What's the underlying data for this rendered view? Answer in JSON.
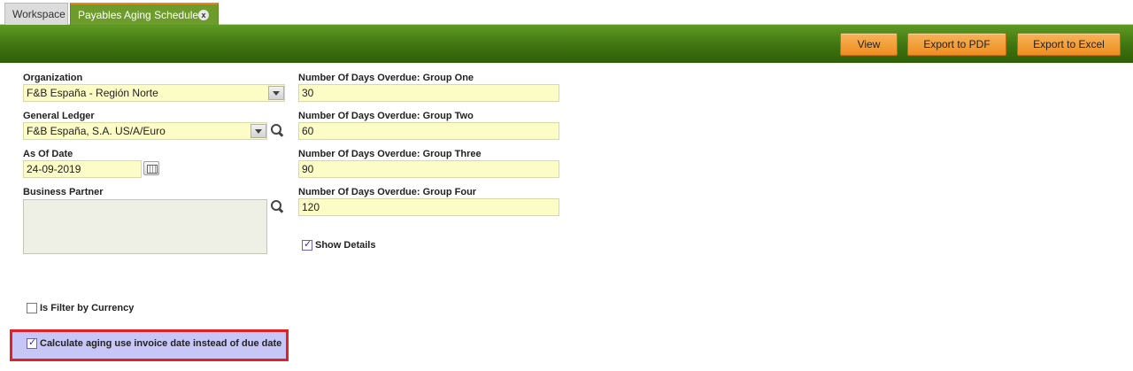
{
  "tabs": {
    "workspace": "Workspace",
    "active": "Payables Aging Schedule",
    "close_glyph": "x"
  },
  "toolbar": {
    "view": "View",
    "export_pdf": "Export to PDF",
    "export_excel": "Export to Excel"
  },
  "form": {
    "organization": {
      "label": "Organization",
      "value": "F&B España - Región Norte"
    },
    "general_ledger": {
      "label": "General Ledger",
      "value": "F&B España, S.A. US/A/Euro"
    },
    "as_of_date": {
      "label": "As Of Date",
      "value": "24-09-2019"
    },
    "business_partner": {
      "label": "Business Partner",
      "value": ""
    },
    "group_one": {
      "label": "Number Of Days Overdue: Group One",
      "value": "30"
    },
    "group_two": {
      "label": "Number Of Days Overdue: Group Two",
      "value": "60"
    },
    "group_three": {
      "label": "Number Of Days Overdue: Group Three",
      "value": "90"
    },
    "group_four": {
      "label": "Number Of Days Overdue: Group Four",
      "value": "120"
    },
    "show_details": {
      "label": "Show Details",
      "checked": true
    },
    "filter_by_currency": {
      "label": "Is Filter by Currency",
      "checked": false
    },
    "invoice_date_aging": {
      "label": "Calculate aging use invoice date instead of due date",
      "checked": true
    }
  },
  "colors": {
    "toolbar_green": "#3f7410",
    "active_tab": "#6d9c2c",
    "button_orange": "#ee8d1f",
    "field_yellow": "#fcfcc6",
    "highlight_red": "#e32026",
    "highlight_fill": "#c6c6f7"
  }
}
